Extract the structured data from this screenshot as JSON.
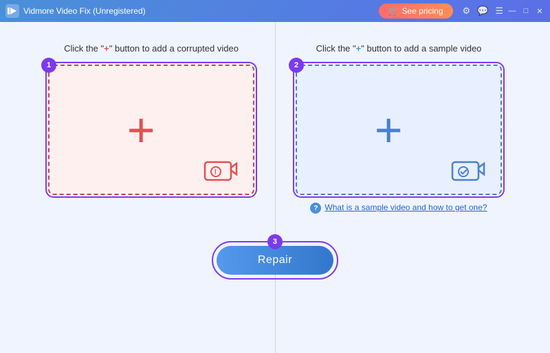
{
  "titleBar": {
    "appName": "Vidmore Video Fix (Unregistered)",
    "seePricingLabel": "See pricing",
    "icons": {
      "link": "🔗",
      "chat": "💬",
      "menu": "☰",
      "minimize": "—",
      "maximize": "□",
      "close": "✕"
    }
  },
  "panels": {
    "left": {
      "instruction": "Click the \"+\" button to add a corrupted video",
      "plusChar": "+",
      "badgeNumber": "1",
      "dropZoneAriaLabel": "Add corrupted video drop zone"
    },
    "right": {
      "instruction": "Click the \"+\" button to add a sample video",
      "plusChar": "+",
      "badgeNumber": "2",
      "dropZoneAriaLabel": "Add sample video drop zone",
      "helpText": "What is a sample video and how to get one?"
    }
  },
  "repairSection": {
    "badgeNumber": "3",
    "repairLabel": "Repair"
  },
  "colors": {
    "purple": "#7c3aed",
    "red": "#e05050",
    "blue": "#4a80d0",
    "accentBlue": "#4a90d9"
  }
}
